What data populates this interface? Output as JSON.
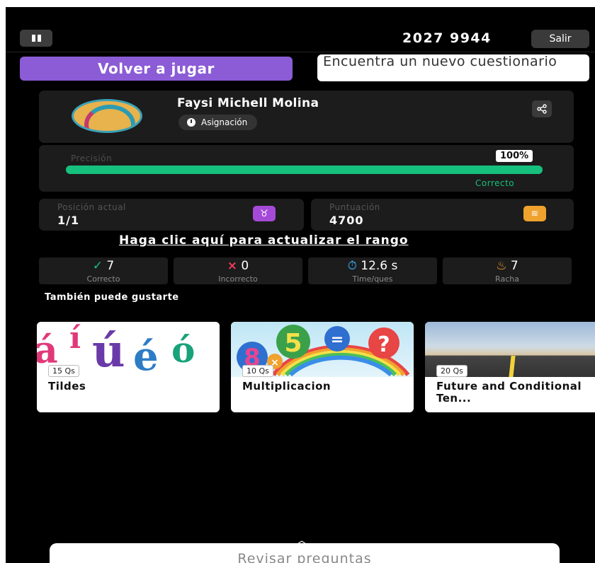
{
  "header": {
    "game_code": "2027 9944",
    "exit_label": "Salir",
    "pause_icon": "pause-icon"
  },
  "actions": {
    "play_again": "Volver a jugar",
    "find_new_quiz": "Encuentra un nuevo cuestionario"
  },
  "profile": {
    "name": "Faysi Michell Molina",
    "badge": "Asignación",
    "share_icon": "share-icon"
  },
  "accuracy": {
    "label": "Precisión",
    "percent_label": "100%",
    "value": 1.0,
    "status": "Correcto"
  },
  "position": {
    "label": "Posición actual",
    "value": "1/1",
    "icon": "medal-icon"
  },
  "score": {
    "label": "Puntuación",
    "value": "4700",
    "icon": "coins-icon"
  },
  "rank_link": "Haga clic aquí para actualizar el rango",
  "stats": [
    {
      "icon": "check-icon",
      "value": "7",
      "label": "Correcto"
    },
    {
      "icon": "x-icon",
      "value": "0",
      "label": "Incorrecto"
    },
    {
      "icon": "timer-icon",
      "value": "12.6 s",
      "label": "Time/ques"
    },
    {
      "icon": "flame-icon",
      "value": "7",
      "label": "Racha"
    }
  ],
  "recommendations": {
    "title": "También puede gustarte",
    "items": [
      {
        "count": "15 Qs",
        "title": "Tildes"
      },
      {
        "count": "10 Qs",
        "title": "Multiplicacion"
      },
      {
        "count": "20 Qs",
        "title": "Future and Conditional Ten..."
      }
    ]
  },
  "footer": {
    "review_label": "Revisar preguntas"
  },
  "colors": {
    "accent_purple": "#8b5cd6",
    "success_green": "#16c07d",
    "error_red": "#ef3a5d",
    "timer_blue": "#3aa7ee",
    "streak_orange": "#f0a22e"
  }
}
